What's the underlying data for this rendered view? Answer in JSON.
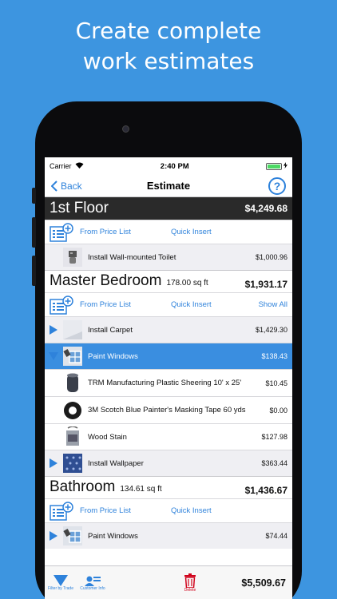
{
  "promo": {
    "line1": "Create complete",
    "line2": "work estimates"
  },
  "status": {
    "carrier": "Carrier",
    "time": "2:40 PM"
  },
  "nav": {
    "back_label": "Back",
    "title": "Estimate",
    "help_label": "?"
  },
  "sections": {
    "first_floor": {
      "name": "1st Floor",
      "total": "$4,249.68",
      "from_price_list": "From Price List",
      "quick_insert": "Quick Insert",
      "items": [
        {
          "name": "Install Wall-mounted Toilet",
          "price": "$1,000.96"
        }
      ]
    },
    "master_bedroom": {
      "name": "Master Bedroom",
      "sqft": "178.00 sq ft",
      "total": "$1,931.17",
      "from_price_list": "From Price List",
      "quick_insert": "Quick Insert",
      "show_all": "Show All",
      "items": [
        {
          "name": "Install Carpet",
          "price": "$1,429.30"
        },
        {
          "name": "Paint Windows",
          "price": "$138.43"
        },
        {
          "name": "TRM Manufacturing Plastic Sheering 10' x 25'",
          "price": "$10.45"
        },
        {
          "name": "3M Scotch Blue Painter's Masking Tape 60 yds",
          "price": "$0.00"
        },
        {
          "name": "Wood Stain",
          "price": "$127.98"
        },
        {
          "name": "Install Wallpaper",
          "price": "$363.44"
        }
      ]
    },
    "bathroom": {
      "name": "Bathroom",
      "sqft": "134.61 sq ft",
      "total": "$1,436.67",
      "from_price_list": "From Price List",
      "quick_insert": "Quick Insert",
      "items": [
        {
          "name": "Paint Windows",
          "price": "$74.44"
        }
      ]
    }
  },
  "tabbar": {
    "filter_label": "Filter by Trade",
    "customer_label": "Customer Info",
    "delete_label": "Delete",
    "grand_total": "$5,509.67"
  },
  "colors": {
    "background": "#3d95e0",
    "accent": "#2e82db",
    "selected_row": "#3a8ee0",
    "delete": "#d0021b"
  }
}
